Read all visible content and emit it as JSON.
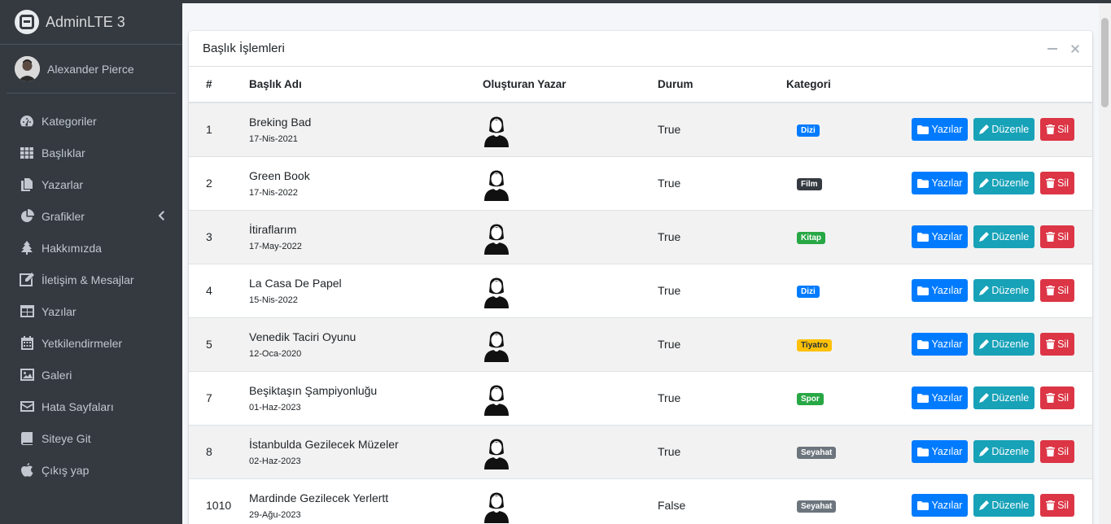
{
  "brand": {
    "name": "AdminLTE 3"
  },
  "user": {
    "name": "Alexander Pierce"
  },
  "sidebar": {
    "items": [
      {
        "label": "Kategoriler",
        "icon": "dashboard-gauge-icon"
      },
      {
        "label": "Başlıklar",
        "icon": "grid-icon"
      },
      {
        "label": "Yazarlar",
        "icon": "copy-icon"
      },
      {
        "label": "Grafikler",
        "icon": "pie-chart-icon"
      },
      {
        "label": "Hakkımızda",
        "icon": "tree-icon"
      },
      {
        "label": "İletişim & Mesajlar",
        "icon": "edit-icon"
      },
      {
        "label": "Yazılar",
        "icon": "table-icon"
      },
      {
        "label": "Yetkilendirmeler",
        "icon": "calendar-icon"
      },
      {
        "label": "Galeri",
        "icon": "image-icon"
      },
      {
        "label": "Hata Sayfaları",
        "icon": "envelope-icon"
      },
      {
        "label": "Siteye Git",
        "icon": "book-icon"
      },
      {
        "label": "Çıkış yap",
        "icon": "apple-icon"
      }
    ]
  },
  "card": {
    "title": "Başlık İşlemleri"
  },
  "table": {
    "headers": [
      "#",
      "Başlık Adı",
      "Oluşturan Yazar",
      "Durum",
      "Kategori"
    ],
    "rows": [
      {
        "id": "1",
        "title": "Breking Bad",
        "date": "17-Nis-2021",
        "status": "True",
        "category": "Dizi",
        "category_color": "#007bff"
      },
      {
        "id": "2",
        "title": "Green Book",
        "date": "17-Nis-2022",
        "status": "True",
        "category": "Film",
        "category_color": "#343a40"
      },
      {
        "id": "3",
        "title": "İtiraflarım",
        "date": "17-May-2022",
        "status": "True",
        "category": "Kitap",
        "category_color": "#28a745"
      },
      {
        "id": "4",
        "title": "La Casa De Papel",
        "date": "15-Nis-2022",
        "status": "True",
        "category": "Dizi",
        "category_color": "#007bff"
      },
      {
        "id": "5",
        "title": "Venedik Taciri Oyunu",
        "date": "12-Oca-2020",
        "status": "True",
        "category": "Tiyatro",
        "category_color": "#ffc107"
      },
      {
        "id": "7",
        "title": "Beşiktaşın Şampiyonluğu",
        "date": "01-Haz-2023",
        "status": "True",
        "category": "Spor",
        "category_color": "#28a745"
      },
      {
        "id": "8",
        "title": "İstanbulda Gezilecek Müzeler",
        "date": "02-Haz-2023",
        "status": "True",
        "category": "Seyahat",
        "category_color": "#6c757d"
      },
      {
        "id": "1010",
        "title": "Mardinde Gezilecek Yerlertt",
        "date": "29-Ağu-2023",
        "status": "False",
        "category": "Seyahat",
        "category_color": "#6c757d"
      }
    ]
  },
  "actions": {
    "posts": "Yazılar",
    "edit": "Düzenle",
    "delete": "Sil"
  },
  "colors": {
    "sidebar_bg": "#343a40",
    "primary": "#007bff",
    "info": "#17a2b8",
    "danger": "#dc3545"
  }
}
